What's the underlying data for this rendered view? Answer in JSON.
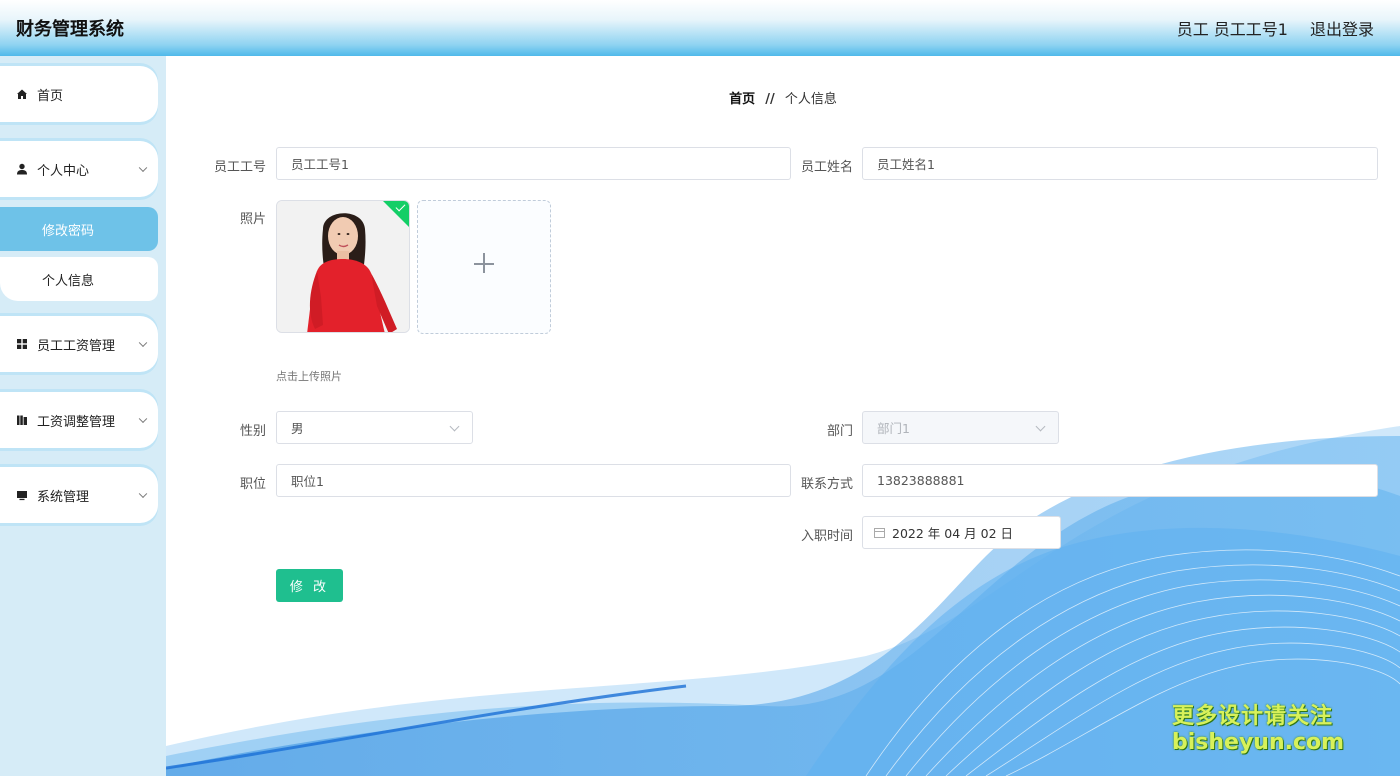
{
  "header": {
    "app_title": "财务管理系统",
    "user_label": "员工 员工工号1",
    "logout_label": "退出登录"
  },
  "sidebar": {
    "items": [
      {
        "label": "首页",
        "icon": "home-icon"
      },
      {
        "label": "个人中心",
        "icon": "user-icon"
      },
      {
        "label": "员工工资管理",
        "icon": "grid-icon"
      },
      {
        "label": "工资调整管理",
        "icon": "book-icon"
      },
      {
        "label": "系统管理",
        "icon": "monitor-icon"
      }
    ],
    "sub_items": [
      {
        "label": "修改密码",
        "active": true
      },
      {
        "label": "个人信息",
        "active": false
      }
    ]
  },
  "breadcrumb": {
    "home": "首页",
    "separator": "//",
    "current": "个人信息"
  },
  "form": {
    "employee_no": {
      "label": "员工工号",
      "value": "员工工号1"
    },
    "employee_name": {
      "label": "员工姓名",
      "value": "员工姓名1"
    },
    "photo": {
      "label": "照片",
      "hint": "点击上传照片"
    },
    "gender": {
      "label": "性别",
      "value": "男"
    },
    "department": {
      "label": "部门",
      "value": "部门1"
    },
    "position": {
      "label": "职位",
      "value": "职位1"
    },
    "contact": {
      "label": "联系方式",
      "value": "13823888881"
    },
    "hire_date": {
      "label": "入职时间",
      "value": "2022 年 04 月 02 日"
    },
    "submit_label": "修 改"
  },
  "watermark": {
    "line1": "更多设计请关注",
    "line2": "bisheyun.com"
  },
  "colors": {
    "accent": "#6ec2e8",
    "submit": "#1fbf8f",
    "sidebar_bg": "#d6ecf7"
  }
}
